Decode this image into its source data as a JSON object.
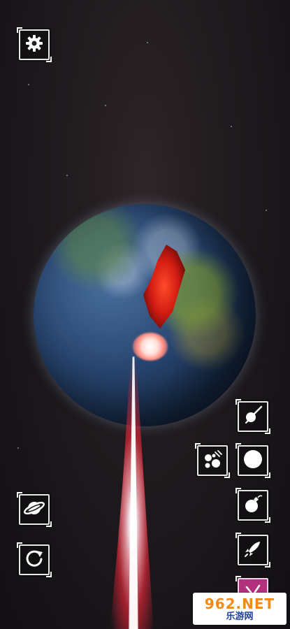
{
  "toolbar": {
    "settings": {
      "icon": "gear-icon"
    },
    "left": [
      {
        "icon": "planet-ring-icon"
      },
      {
        "icon": "rotate-icon"
      }
    ],
    "right": [
      {
        "icon": "comet-icon"
      },
      {
        "icon": "meteor-shower-icon"
      },
      {
        "icon": "sphere-icon"
      },
      {
        "icon": "bomb-icon"
      },
      {
        "icon": "rocket-icon"
      },
      {
        "icon": "laser-icon",
        "active": true
      }
    ]
  },
  "colors": {
    "accent": "#b2307e",
    "laser": "#ff3040",
    "planet": "#27446e"
  },
  "watermark": {
    "main": "962.NET",
    "sub": "乐游网"
  }
}
